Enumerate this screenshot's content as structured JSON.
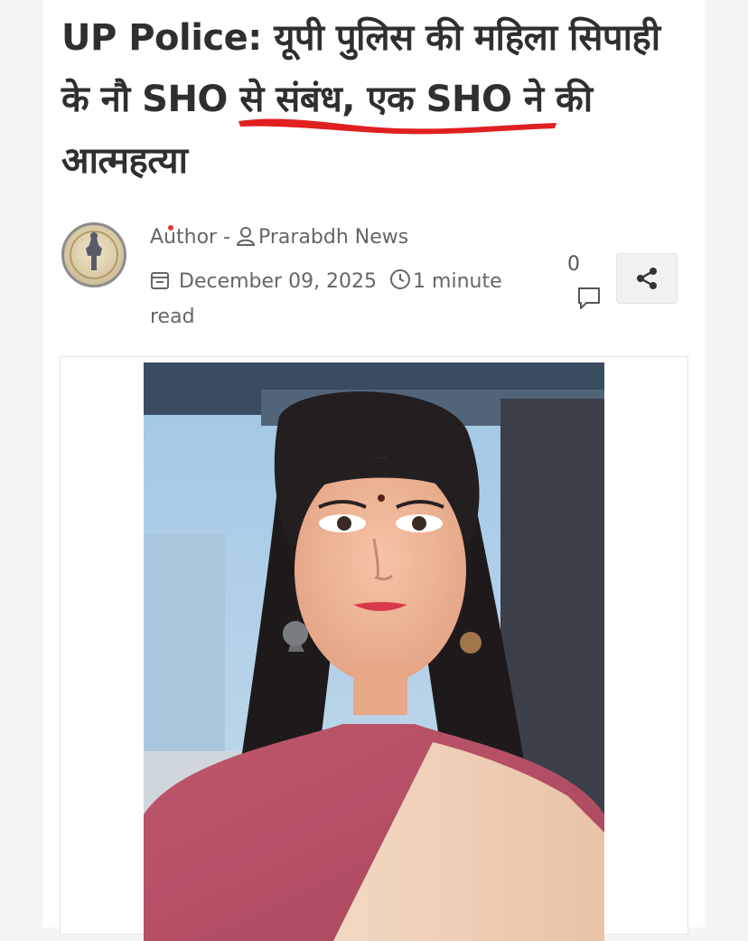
{
  "article": {
    "title": "UP Police: यूपी पुलिस की महिला सिपाही के नौ SHO से संबंध, एक SHO ने की आत्महत्या"
  },
  "meta": {
    "author_label": "Author - ",
    "author_name": "Prarabdh News",
    "date": "December 09, 2025",
    "read_time_a": "1 minute",
    "read_time_b": "read",
    "comment_count": "0"
  },
  "icons": {
    "author": "user-icon",
    "date": "calendar-icon",
    "time": "clock-icon",
    "comments": "comment-icon",
    "share": "share-icon"
  },
  "colors": {
    "title": "#2f2f2f",
    "meta": "#666666",
    "underline_mark": "#e02020",
    "share_bg": "#f1f1f1"
  }
}
